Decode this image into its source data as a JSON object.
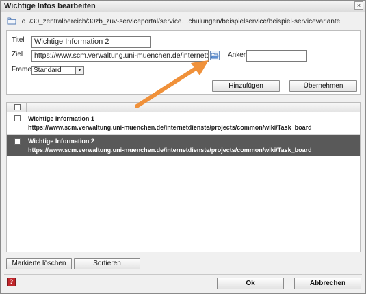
{
  "window": {
    "title": "Wichtige Infos bearbeiten",
    "close_glyph": "×"
  },
  "path": {
    "marker": "o",
    "text": "/30_zentralbereich/30zb_zuv-serviceportal/service…chulungen/beispielservice/beispiel-servicevariante"
  },
  "form": {
    "title_label": "Titel",
    "title_value": "Wichtige Information 2",
    "target_label": "Ziel",
    "target_value": "https://www.scm.verwaltung.uni-muenchen.de/internetdienste/projects/common/wiki/Task_board",
    "anchor_label": "Anker",
    "anchor_value": "",
    "frame_label": "Frame",
    "frame_value": "Standard",
    "add_button": "Hinzufügen",
    "apply_button": "Übernehmen"
  },
  "list": {
    "items": [
      {
        "title": "Wichtige Information 1",
        "url": "https://www.scm.verwaltung.uni-muenchen.de/internetdienste/projects/common/wiki/Task_board",
        "selected": false
      },
      {
        "title": "Wichtige Information 2",
        "url": "https://www.scm.verwaltung.uni-muenchen.de/internetdienste/projects/common/wiki/Task_board",
        "selected": true
      }
    ]
  },
  "actions": {
    "delete_marked": "Markierte löschen",
    "sort": "Sortieren"
  },
  "footer": {
    "help_glyph": "?",
    "ok": "Ok",
    "cancel": "Abbrechen"
  },
  "colors": {
    "selected_row": "#595959",
    "arrow": "#f0913a",
    "help": "#c0262b"
  },
  "icons": {
    "path_folder": "folder-icon",
    "browse": "folder-open-icon",
    "help": "help-icon",
    "annotation": "arrow-annotation"
  }
}
